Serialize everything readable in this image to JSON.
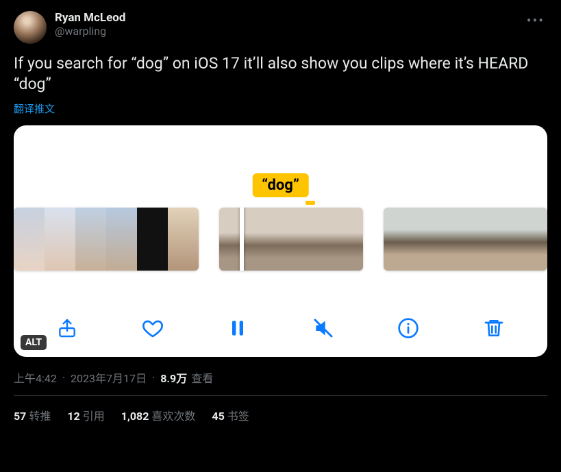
{
  "user": {
    "display_name": "Ryan McLeod",
    "handle": "@warpling"
  },
  "tweet": {
    "text": "If you search for “dog” on iOS 17 it’ll also show you clips where it’s HEARD “dog”",
    "translate_label": "翻译推文"
  },
  "media": {
    "callout_label": "“dog”",
    "alt_badge": "ALT"
  },
  "meta": {
    "time": "上午4:42",
    "date": "2023年7月17日",
    "views_count": "8.9万",
    "views_label": "查看"
  },
  "stats": {
    "retweets_count": "57",
    "retweets_label": "转推",
    "quotes_count": "12",
    "quotes_label": "引用",
    "likes_count": "1,082",
    "likes_label": "喜欢次数",
    "bookmarks_count": "45",
    "bookmarks_label": "书签"
  }
}
